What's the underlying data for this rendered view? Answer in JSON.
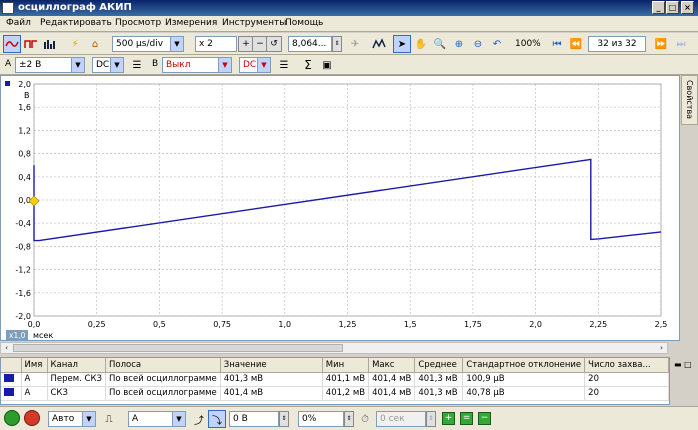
{
  "window": {
    "title": "осциллограф АКИП"
  },
  "menu": [
    "Файл",
    "Редактировать",
    "Просмотр",
    "Измерения",
    "Инструменты",
    "Помощь"
  ],
  "toolbar": {
    "timebase": "500 µs/div",
    "zoom": "x 2",
    "samples": "8,064...",
    "zoom_percent": "100%",
    "capture_counter": "32 из 32"
  },
  "channel_a": {
    "label": "A",
    "range": "±2 В",
    "coupling": "DC"
  },
  "channel_b": {
    "label": "B",
    "range": "Выкл",
    "coupling": "DC",
    "range_color": "#cc0000"
  },
  "sidebar": {
    "properties_tab": "Свойства"
  },
  "chart_data": {
    "type": "line",
    "y_unit": "В",
    "x_unit": "мсек",
    "x_scale_badge": "x1,0",
    "xlim": [
      0,
      2.5
    ],
    "ylim": [
      -2.0,
      2.0
    ],
    "y_ticks": [
      "2,0",
      "1,6",
      "1,2",
      "0,8",
      "0,4",
      "0,0",
      "-0,4",
      "-0,8",
      "-1,2",
      "-1,6",
      "-2,0"
    ],
    "y_tick_values": [
      2.0,
      1.6,
      1.2,
      0.8,
      0.4,
      0.0,
      -0.4,
      -0.8,
      -1.2,
      -1.6,
      -2.0
    ],
    "x_ticks": [
      "0,0",
      "0,25",
      "0,5",
      "0,75",
      "1,0",
      "1,25",
      "1,5",
      "1,75",
      "2,0",
      "2,25",
      "2,5"
    ],
    "x_tick_values": [
      0,
      0.25,
      0.5,
      0.75,
      1.0,
      1.25,
      1.5,
      1.75,
      2.0,
      2.25,
      2.5
    ],
    "grid": true,
    "line_color": "#1a1aaa",
    "series": [
      {
        "x": [
          0.0,
          0.0,
          0.02,
          2.22,
          2.22,
          2.25,
          2.5
        ],
        "y": [
          0.6,
          -0.7,
          -0.7,
          0.7,
          -0.68,
          -0.67,
          -0.55
        ]
      }
    ]
  },
  "measurements": {
    "columns": [
      "Имя",
      "Канал",
      "Полоса",
      "Значение",
      "Мин",
      "Макс",
      "Среднее",
      "Стандартное отклонение",
      "Число захва..."
    ],
    "rows": [
      [
        "A",
        "Перем. СКЗ",
        "По всей осциллограмме",
        "401,3 мВ",
        "401,1 мВ",
        "401,4 мВ",
        "401,3 мВ",
        "100,9 µВ",
        "20"
      ],
      [
        "A",
        "СКЗ",
        "По всей осциллограмме",
        "401,4 мВ",
        "401,2 мВ",
        "401,4 мВ",
        "401,3 мВ",
        "40,78 µВ",
        "20"
      ]
    ]
  },
  "bottombar": {
    "trigger_mode": "Авто",
    "trigger_channel": "A",
    "trigger_level": "0 В",
    "pretrigger": "0%",
    "delay": "0 сек"
  },
  "colors": {
    "accent": "#0a246a",
    "trace": "#1a1aaa",
    "grid": "#c0c0c0"
  }
}
